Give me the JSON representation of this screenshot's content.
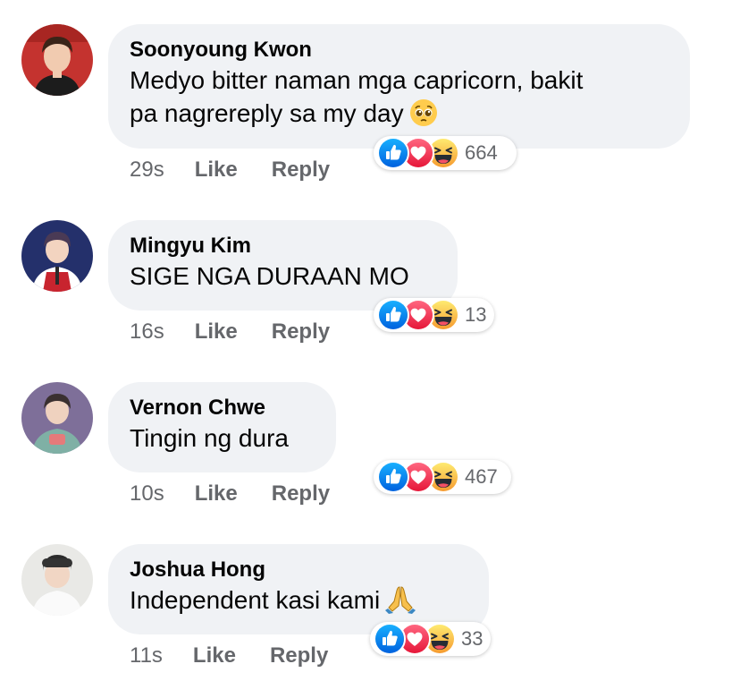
{
  "colors": {
    "bubble_bg": "#f0f2f5",
    "meta_text": "#65676b",
    "like_blue": "#1877f2",
    "love_red": "#f33e58",
    "haha_yellow": "#f7b125"
  },
  "comments": [
    {
      "author": "Soonyoung Kwon",
      "text_line1": "Medyo bitter naman mga capricorn, bakit",
      "text_line2": "pa nagrereply sa my day",
      "emoji": "pleading-face",
      "time": "29s",
      "like_label": "Like",
      "reply_label": "Reply",
      "reactions": [
        "like-icon",
        "love-icon",
        "haha-icon"
      ],
      "reaction_count": "664"
    },
    {
      "author": "Mingyu Kim",
      "text_line1": "SIGE NGA DURAAN MO",
      "time": "16s",
      "like_label": "Like",
      "reply_label": "Reply",
      "reactions": [
        "like-icon",
        "love-icon",
        "haha-icon"
      ],
      "reaction_count": "13"
    },
    {
      "author": "Vernon Chwe",
      "text_line1": "Tingin ng dura",
      "time": "10s",
      "like_label": "Like",
      "reply_label": "Reply",
      "reactions": [
        "like-icon",
        "love-icon",
        "haha-icon"
      ],
      "reaction_count": "467"
    },
    {
      "author": "Joshua Hong",
      "text_line1": "Independent kasi kami",
      "emoji": "folded-hands",
      "time": "11s",
      "like_label": "Like",
      "reply_label": "Reply",
      "reactions": [
        "like-icon",
        "love-icon",
        "haha-icon"
      ],
      "reaction_count": "33"
    }
  ]
}
